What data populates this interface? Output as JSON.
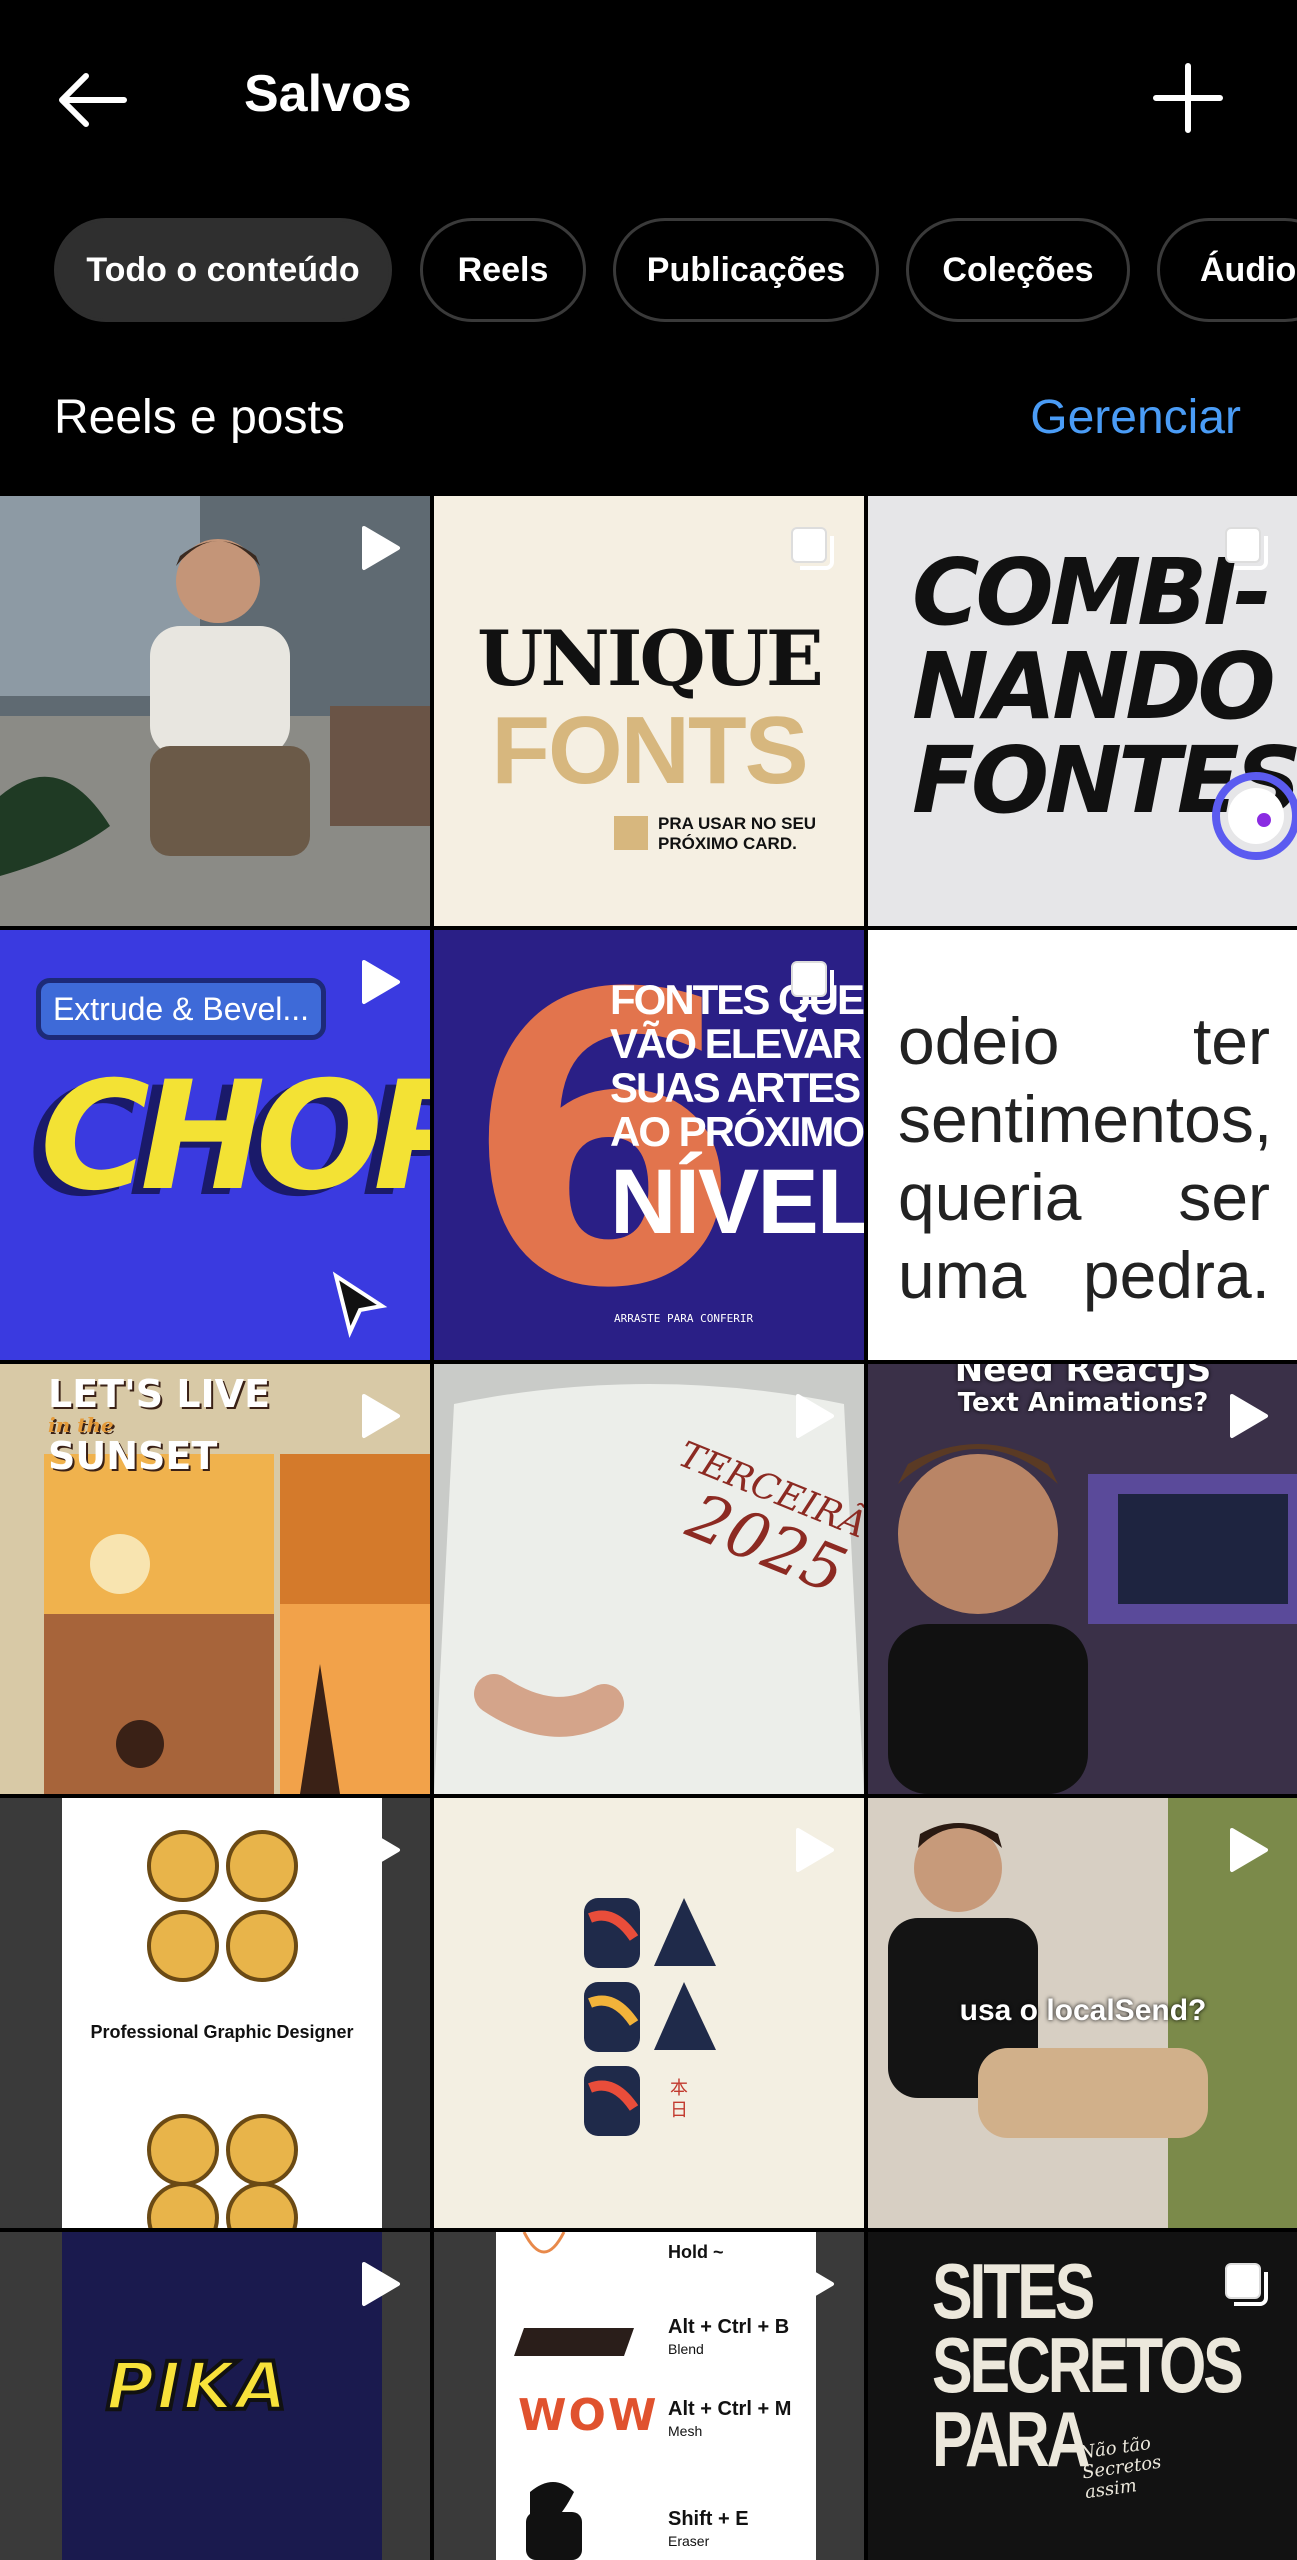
{
  "header": {
    "title": "Salvos",
    "back_icon": "arrow-left-icon",
    "add_icon": "plus-icon"
  },
  "filters": [
    {
      "label": "Todo o conteúdo",
      "active": true
    },
    {
      "label": "Reels",
      "active": false
    },
    {
      "label": "Publicações",
      "active": false
    },
    {
      "label": "Coleções",
      "active": false
    },
    {
      "label": "Áudio",
      "active": false
    }
  ],
  "section": {
    "title": "Reels e posts",
    "manage_label": "Gerenciar"
  },
  "colors": {
    "accent": "#4a9cf6",
    "background": "#000000",
    "chip_active": "#2f2f2f",
    "chip_border": "#3a3a3a"
  },
  "posts": [
    {
      "kind": "reel",
      "badge": "play-icon"
    },
    {
      "kind": "carousel",
      "badge": "carousel-icon",
      "texts": [
        "UNIQUE",
        "FONTS",
        "PRA USAR NO SEU",
        "PRÓXIMO CARD."
      ]
    },
    {
      "kind": "carousel",
      "badge": "carousel-icon",
      "texts": [
        "COMBI-",
        "NANDO",
        "FONTES"
      ]
    },
    {
      "kind": "reel",
      "badge": "play-icon",
      "texts": [
        "Extrude & Bevel...",
        "CHOPE"
      ]
    },
    {
      "kind": "carousel",
      "badge": "carousel-icon",
      "texts": [
        "6",
        "FONTES QUE",
        "VÃO ELEVAR",
        "SUAS ARTES",
        "AO PRÓXIMO",
        "NÍVEL",
        "ARRASTE PARA CONFERIR"
      ]
    },
    {
      "kind": "image",
      "texts": [
        "odeio",
        "ter",
        "sentimentos,",
        "queria",
        "ser",
        "uma",
        "pedra."
      ]
    },
    {
      "kind": "reel",
      "badge": "play-icon",
      "texts": [
        "LET'S LIVE",
        "in the",
        "SUNSET"
      ]
    },
    {
      "kind": "reel",
      "badge": "play-icon",
      "texts": [
        "TERCEIRÃO",
        "2025"
      ]
    },
    {
      "kind": "reel",
      "badge": "play-icon",
      "texts": [
        "Need ReactJS",
        "Text Animations?"
      ]
    },
    {
      "kind": "reel",
      "badge": "play-icon",
      "texts": [
        "Professional Graphic Designer"
      ]
    },
    {
      "kind": "reel",
      "badge": "play-icon",
      "texts": [
        "本",
        "日"
      ]
    },
    {
      "kind": "reel",
      "badge": "play-icon",
      "texts": [
        "usa o localSend?"
      ]
    },
    {
      "kind": "reel",
      "badge": "play-icon",
      "texts": [
        "PIKA"
      ]
    },
    {
      "kind": "reel",
      "badge": "play-icon",
      "texts": [
        "Hold ~",
        "Alt + Ctrl + B",
        "Blend",
        "WOW",
        "Alt + Ctrl + M",
        "Mesh",
        "Shift + E",
        "Eraser"
      ]
    },
    {
      "kind": "carousel",
      "badge": "carousel-icon",
      "texts": [
        "SITES",
        "SECRETOS",
        "PARA",
        "Não tão",
        "Secretos",
        "assim"
      ]
    }
  ]
}
